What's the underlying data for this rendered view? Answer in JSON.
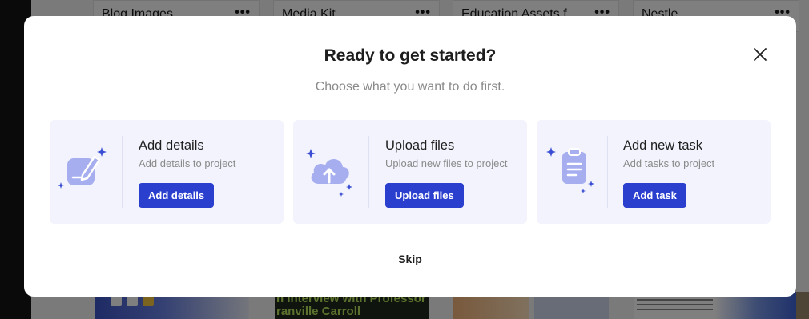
{
  "background": {
    "cards": [
      {
        "title": "Blog Images",
        "menu": "•••"
      },
      {
        "title": "Media Kit",
        "menu": "•••"
      },
      {
        "title": "Education Assets f",
        "menu": "•••"
      },
      {
        "title": "Nestle",
        "menu": "•••"
      }
    ],
    "thumbnail_text": "n Interview with Professor\nranville Carroll"
  },
  "modal": {
    "title": "Ready to get started?",
    "subtitle": "Choose what you want to do first.",
    "close_icon": "close-icon",
    "options": [
      {
        "icon": "edit-icon",
        "title": "Add details",
        "description": "Add details to project",
        "button": "Add details"
      },
      {
        "icon": "cloud-upload-icon",
        "title": "Upload files",
        "description": "Upload new files to project",
        "button": "Upload files"
      },
      {
        "icon": "clipboard-icon",
        "title": "Add new task",
        "description": "Add tasks to project",
        "button": "Add task"
      }
    ],
    "skip_label": "Skip"
  },
  "colors": {
    "primary_button": "#2b3fcf",
    "card_background": "#f2f3fc",
    "icon_fill": "#a6aef0",
    "sparkle": "#3a4ed4"
  }
}
